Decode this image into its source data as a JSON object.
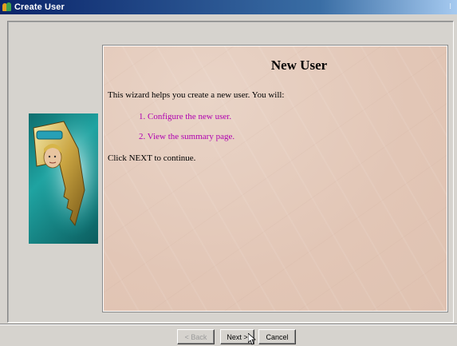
{
  "window": {
    "title": "Create User"
  },
  "wizard": {
    "heading": "New User",
    "intro": "This wizard helps you create a new user. You will:",
    "steps": [
      "1.  Configure the new user.",
      "2.  View the summary page."
    ],
    "cta": "Click NEXT to continue."
  },
  "buttons": {
    "back": "< Back",
    "next": "Next >",
    "cancel": "Cancel"
  },
  "colors": {
    "step_link": "#b000b0",
    "title_bar": "#0a246a",
    "content_bg": "#e2c6b6"
  }
}
